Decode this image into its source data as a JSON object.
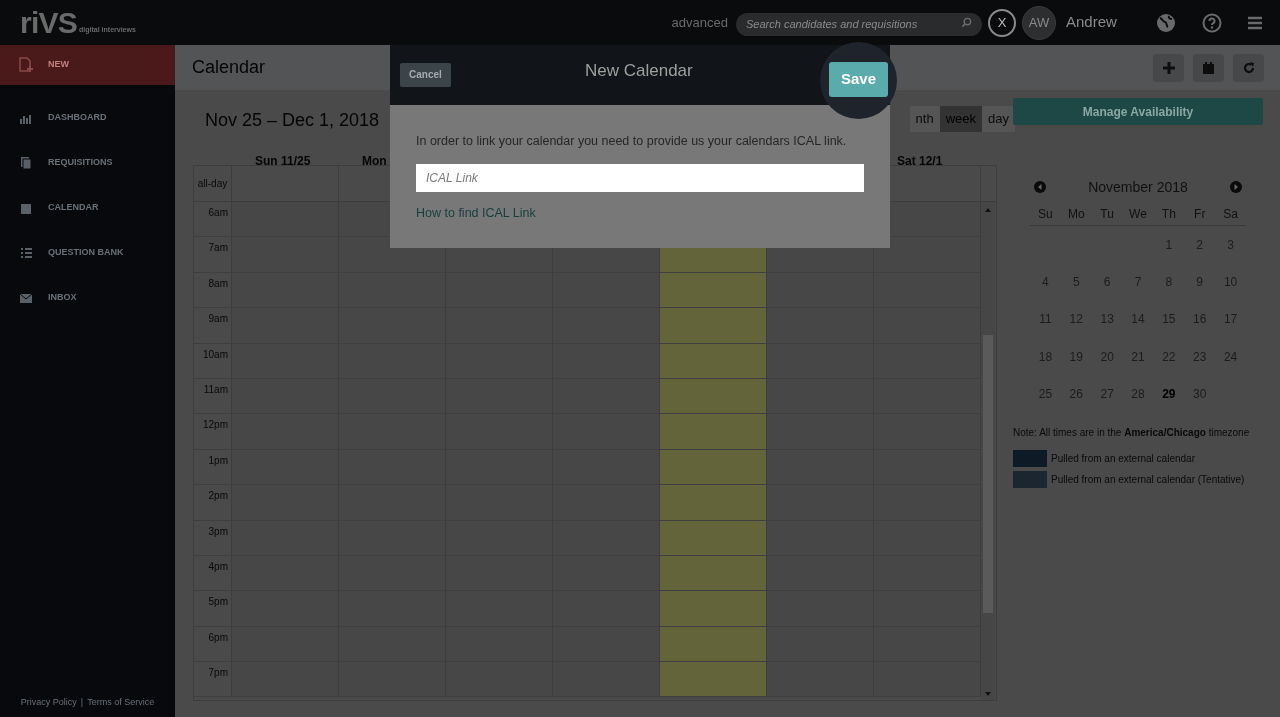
{
  "top_bar": {
    "logo": "riVS",
    "logo_tagline": "digital interviews",
    "advanced_link": "advanced",
    "search": {
      "placeholder": "Search candidates and requisitions"
    },
    "avatar_initials": "AW",
    "user_name": "Andrew"
  },
  "tour": {
    "close": "X"
  },
  "sidebar": {
    "items": [
      {
        "label": "NEW",
        "selected": true
      },
      {
        "label": "DASHBOARD",
        "selected": false
      },
      {
        "label": "REQUISITIONS",
        "selected": false
      },
      {
        "label": "CALENDAR",
        "selected": false
      },
      {
        "label": "QUESTION BANK",
        "selected": false
      },
      {
        "label": "INBOX",
        "selected": false
      }
    ],
    "footer_links": [
      "Privacy Policy",
      "Terms of Service"
    ],
    "footer_separator": "|"
  },
  "page_title": "Calendar",
  "calendar": {
    "range_title": "Nov 25 – Dec 1, 2018",
    "views": [
      {
        "label": "nth",
        "selected": false
      },
      {
        "label": "week",
        "selected": true
      },
      {
        "label": "day",
        "selected": false
      }
    ],
    "days": [
      {
        "label": "Sun 11/25",
        "today": false
      },
      {
        "label": "Mon",
        "today": false
      },
      {
        "today": false
      },
      {
        "today": false
      },
      {
        "today": true
      },
      {
        "today": false
      },
      {
        "label": "Sat 12/1",
        "today": false
      }
    ],
    "all_day_label": "all-day",
    "times": [
      "6am",
      "7am",
      "8am",
      "9am",
      "10am",
      "11am",
      "12pm",
      "1pm",
      "2pm",
      "3pm",
      "4pm",
      "5pm",
      "6pm",
      "7pm"
    ]
  },
  "side_panel": {
    "manage_button": "Manage Availability",
    "mini_calendar": {
      "title": "November 2018",
      "weekdays": [
        "Su",
        "Mo",
        "Tu",
        "We",
        "Th",
        "Fr",
        "Sa"
      ],
      "weeks": [
        {
          "kind": "first",
          "days": [
            {
              "label": "1",
              "today": false
            },
            {
              "label": "2",
              "today": false
            },
            {
              "label": "3",
              "today": false
            }
          ]
        },
        {
          "kind": "regular",
          "days": [
            {
              "label": "4",
              "today": false
            },
            {
              "label": "5",
              "today": false
            },
            {
              "label": "6",
              "today": false
            },
            {
              "label": "7",
              "today": false
            },
            {
              "label": "8",
              "today": false
            },
            {
              "label": "9",
              "today": false
            },
            {
              "label": "10",
              "today": false
            }
          ]
        },
        {
          "kind": "regular",
          "days": [
            {
              "label": "11",
              "today": false
            },
            {
              "label": "12",
              "today": false
            },
            {
              "label": "13",
              "today": false
            },
            {
              "label": "14",
              "today": false
            },
            {
              "label": "15",
              "today": false
            },
            {
              "label": "16",
              "today": false
            },
            {
              "label": "17",
              "today": false
            }
          ]
        },
        {
          "kind": "regular",
          "days": [
            {
              "label": "18",
              "today": false
            },
            {
              "label": "19",
              "today": false
            },
            {
              "label": "20",
              "today": false
            },
            {
              "label": "21",
              "today": false
            },
            {
              "label": "22",
              "today": false
            },
            {
              "label": "23",
              "today": false
            },
            {
              "label": "24",
              "today": false
            }
          ]
        },
        {
          "kind": "regular",
          "days": [
            {
              "label": "25",
              "today": false
            },
            {
              "label": "26",
              "today": false
            },
            {
              "label": "27",
              "today": false
            },
            {
              "label": "28",
              "today": false
            },
            {
              "label": "29",
              "today": true
            },
            {
              "label": "30",
              "today": false
            }
          ]
        }
      ]
    },
    "note": "Note: All times are in the **America/Chicago** timezone",
    "legend": [
      {
        "label": "Pulled from an external calendar",
        "color": "#0f1a27"
      },
      {
        "label": "Pulled from an external calendar (Tentative)",
        "color": "#1c2631"
      }
    ]
  },
  "modal": {
    "title": "New Calendar",
    "cancel": "Cancel",
    "save": "Save",
    "message": "In order to link your calendar you need to provide us your calendars ICAL link.",
    "field": {
      "placeholder": "ICAL Link"
    },
    "help_link": "How to find ICAL Link"
  }
}
